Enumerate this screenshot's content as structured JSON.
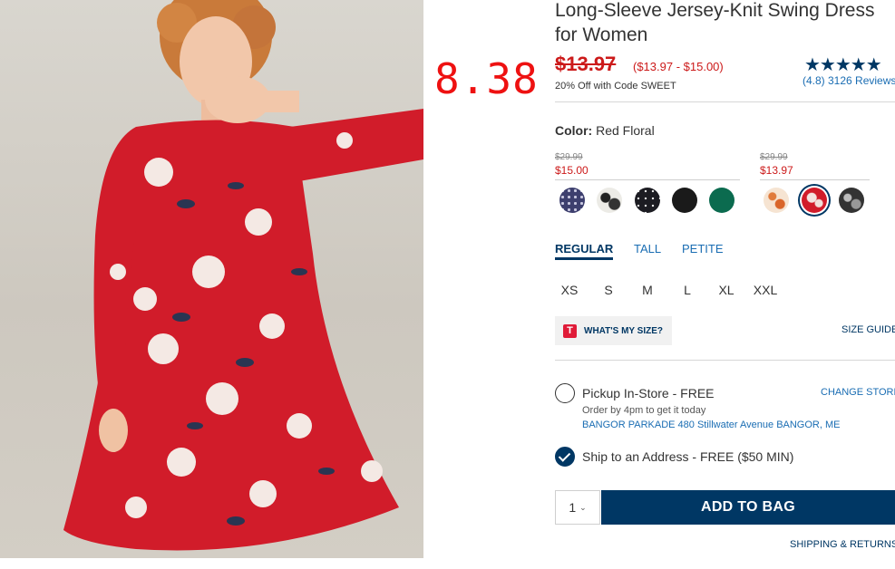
{
  "annotation": {
    "price_note": "8.38"
  },
  "product": {
    "title_line1": "Long-Sleeve Jersey-Knit Swing Dress",
    "title_line2": "for Women",
    "original_price": "$13.97",
    "sale_range": "($13.97 - $15.00)",
    "promo": "20% Off with Code SWEET",
    "stars": "★★★★★",
    "reviews": "(4.8) 3126 Reviews"
  },
  "color": {
    "label": "Color:",
    "value": "Red Floral",
    "groups": [
      {
        "strike": "$29.99",
        "price": "$15.00"
      },
      {
        "strike": "$29.99",
        "price": "$13.97"
      }
    ],
    "swatches": [
      {
        "name": "navy-dot",
        "color": "#3d3f6e"
      },
      {
        "name": "white-black-floral",
        "color": "#e8e6df"
      },
      {
        "name": "black-dot",
        "color": "#1c1c22"
      },
      {
        "name": "black",
        "color": "#1a1a1a"
      },
      {
        "name": "green",
        "color": "#0b6b4f"
      },
      {
        "name": "peach-floral",
        "color": "#f0b58a"
      },
      {
        "name": "red-floral",
        "color": "#d11c2a"
      },
      {
        "name": "black-white-floral",
        "color": "#3a3a3a"
      }
    ]
  },
  "fit": {
    "tabs": [
      "REGULAR",
      "TALL",
      "PETITE"
    ]
  },
  "sizes": [
    "XS",
    "S",
    "M",
    "L",
    "XL",
    "XXL"
  ],
  "whats_my_size": {
    "logo": "T",
    "label": "WHAT'S MY SIZE?"
  },
  "size_guide": "SIZE GUIDE",
  "fulfillment": {
    "pickup": "Pickup In-Store - FREE",
    "change_store": "CHANGE STORE",
    "order_by": "Order by 4pm to get it today",
    "store_address": "BANGOR PARKADE 480 Stillwater Avenue  BANGOR, ME",
    "ship": "Ship to an Address - FREE ($50 MIN)"
  },
  "purchase": {
    "qty": "1",
    "chevron": "⌄",
    "add_to_bag": "ADD TO BAG",
    "shipping_returns": "SHIPPING & RETURNS"
  },
  "colors": {
    "navy": "#003764",
    "sale_red": "#cc1a1a",
    "link_blue": "#1a6db3"
  }
}
